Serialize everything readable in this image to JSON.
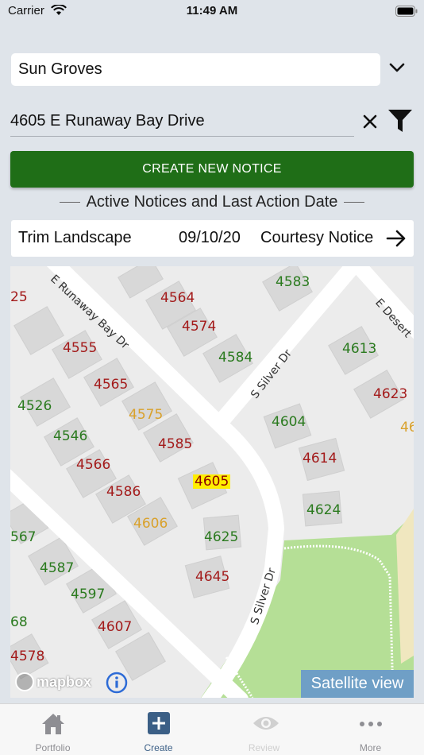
{
  "status_bar": {
    "carrier": "Carrier",
    "time": "11:49 AM"
  },
  "filters": {
    "community": "Sun Groves",
    "address": "4605 E Runaway Bay Drive"
  },
  "create_button_label": "CREATE NEW NOTICE",
  "section_heading": "Active Notices and Last Action Date",
  "notice": {
    "type": "Trim Landscape",
    "date": "09/10/20",
    "status": "Courtesy Notice"
  },
  "map": {
    "streets": [
      "E Runaway Bay Dr",
      "S Silver Dr",
      "S Silver Dr",
      "E Desert"
    ],
    "lots": [
      {
        "n": "4583",
        "c": "green"
      },
      {
        "n": "25",
        "c": "red"
      },
      {
        "n": "4564",
        "c": "red"
      },
      {
        "n": "4574",
        "c": "red"
      },
      {
        "n": "4613",
        "c": "green"
      },
      {
        "n": "4555",
        "c": "red"
      },
      {
        "n": "4584",
        "c": "green"
      },
      {
        "n": "4565",
        "c": "red"
      },
      {
        "n": "4623",
        "c": "red"
      },
      {
        "n": "4526",
        "c": "green"
      },
      {
        "n": "4575",
        "c": "orange"
      },
      {
        "n": "46",
        "c": "orange"
      },
      {
        "n": "4604",
        "c": "green"
      },
      {
        "n": "4546",
        "c": "green"
      },
      {
        "n": "4585",
        "c": "red"
      },
      {
        "n": "4566",
        "c": "red"
      },
      {
        "n": "4614",
        "c": "red"
      },
      {
        "n": "4605",
        "c": "selected"
      },
      {
        "n": "4586",
        "c": "red"
      },
      {
        "n": "4624",
        "c": "green"
      },
      {
        "n": "4606",
        "c": "orange"
      },
      {
        "n": "567",
        "c": "green"
      },
      {
        "n": "4625",
        "c": "green"
      },
      {
        "n": "4587",
        "c": "green"
      },
      {
        "n": "4645",
        "c": "red"
      },
      {
        "n": "4597",
        "c": "green"
      },
      {
        "n": "68",
        "c": "green"
      },
      {
        "n": "4607",
        "c": "red"
      },
      {
        "n": "4578",
        "c": "red"
      }
    ],
    "attribution": "mapbox",
    "satellite_label": "Satellite view"
  },
  "tabs": [
    {
      "label": "Portfolio",
      "icon": "home-icon"
    },
    {
      "label": "Create",
      "icon": "plus-square-icon"
    },
    {
      "label": "Review",
      "icon": "eye-icon"
    },
    {
      "label": "More",
      "icon": "ellipsis-icon"
    }
  ],
  "colors": {
    "primary_green": "#1f6e17",
    "tab_active": "#3b5f86",
    "lot_green": "#2a7a1e",
    "lot_red": "#a31a1a",
    "lot_orange": "#d9a12b",
    "selected_highlight": "#ffee00",
    "park": "#b5df96"
  }
}
